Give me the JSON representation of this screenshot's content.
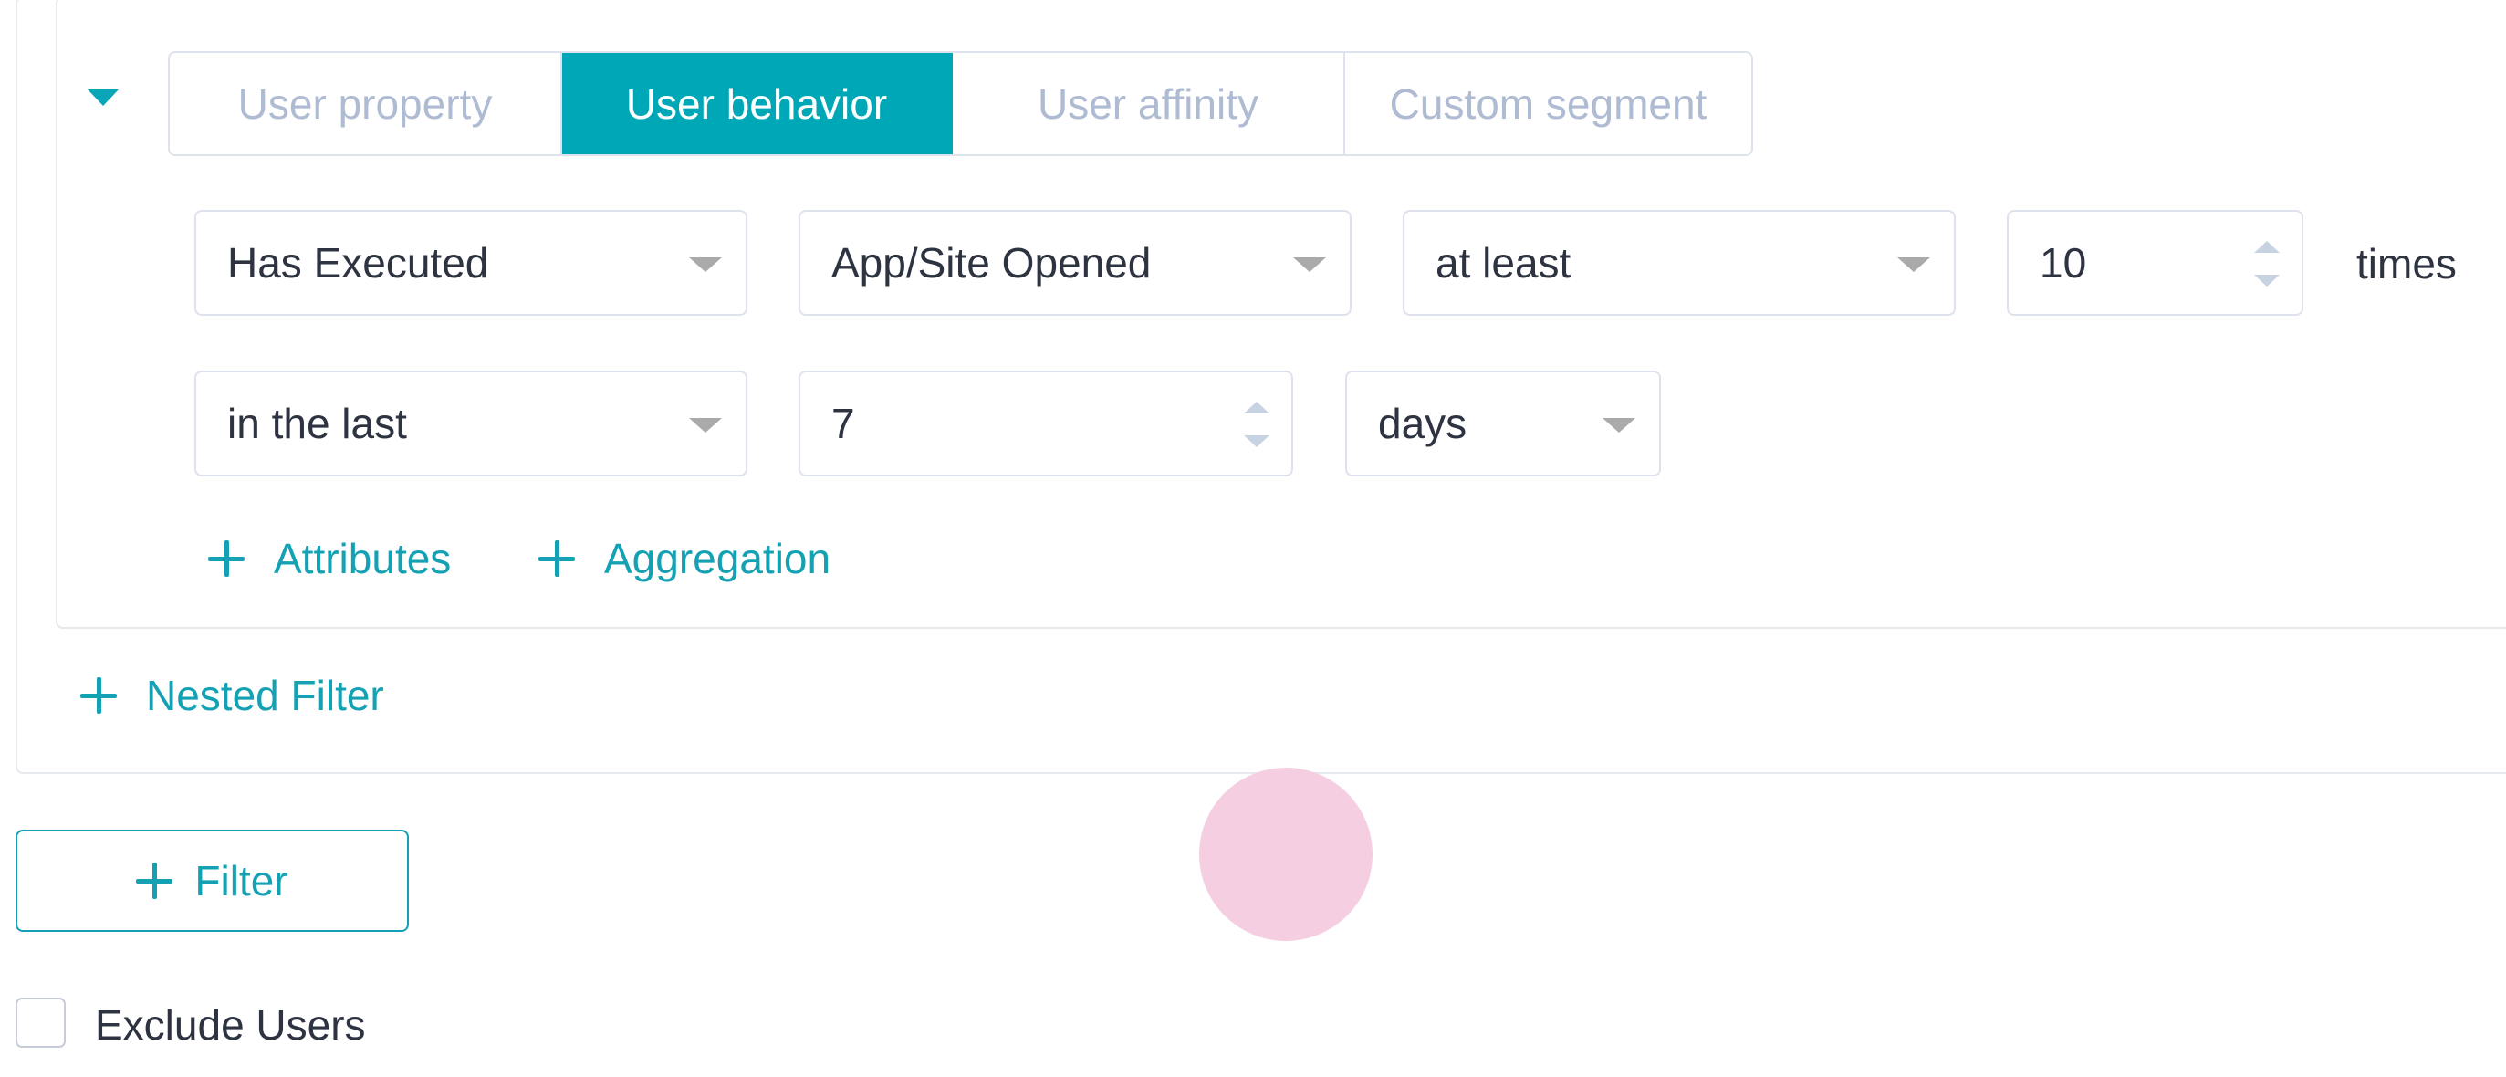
{
  "tabs": [
    {
      "label": "User property",
      "active": false
    },
    {
      "label": "User behavior",
      "active": true
    },
    {
      "label": "User affinity",
      "active": false
    },
    {
      "label": "Custom segment",
      "active": false
    }
  ],
  "condition": {
    "action": "Has Executed",
    "event": "App/Site Opened",
    "comparison": "at least",
    "count": "10",
    "count_unit": "times",
    "time_scope": "in the last",
    "time_value": "7",
    "time_unit": "days"
  },
  "links": {
    "attributes": "Attributes",
    "aggregation": "Aggregation",
    "nested_filter": "Nested Filter"
  },
  "filter_button": "Filter",
  "exclude_users": {
    "label": "Exclude Users",
    "checked": false
  },
  "colors": {
    "accent": "#00a7b7",
    "link": "#13a1b3",
    "inactive_tab_text": "#aebbd2",
    "border": "#dde2ec",
    "click_indicator": "#f5cfe1"
  }
}
